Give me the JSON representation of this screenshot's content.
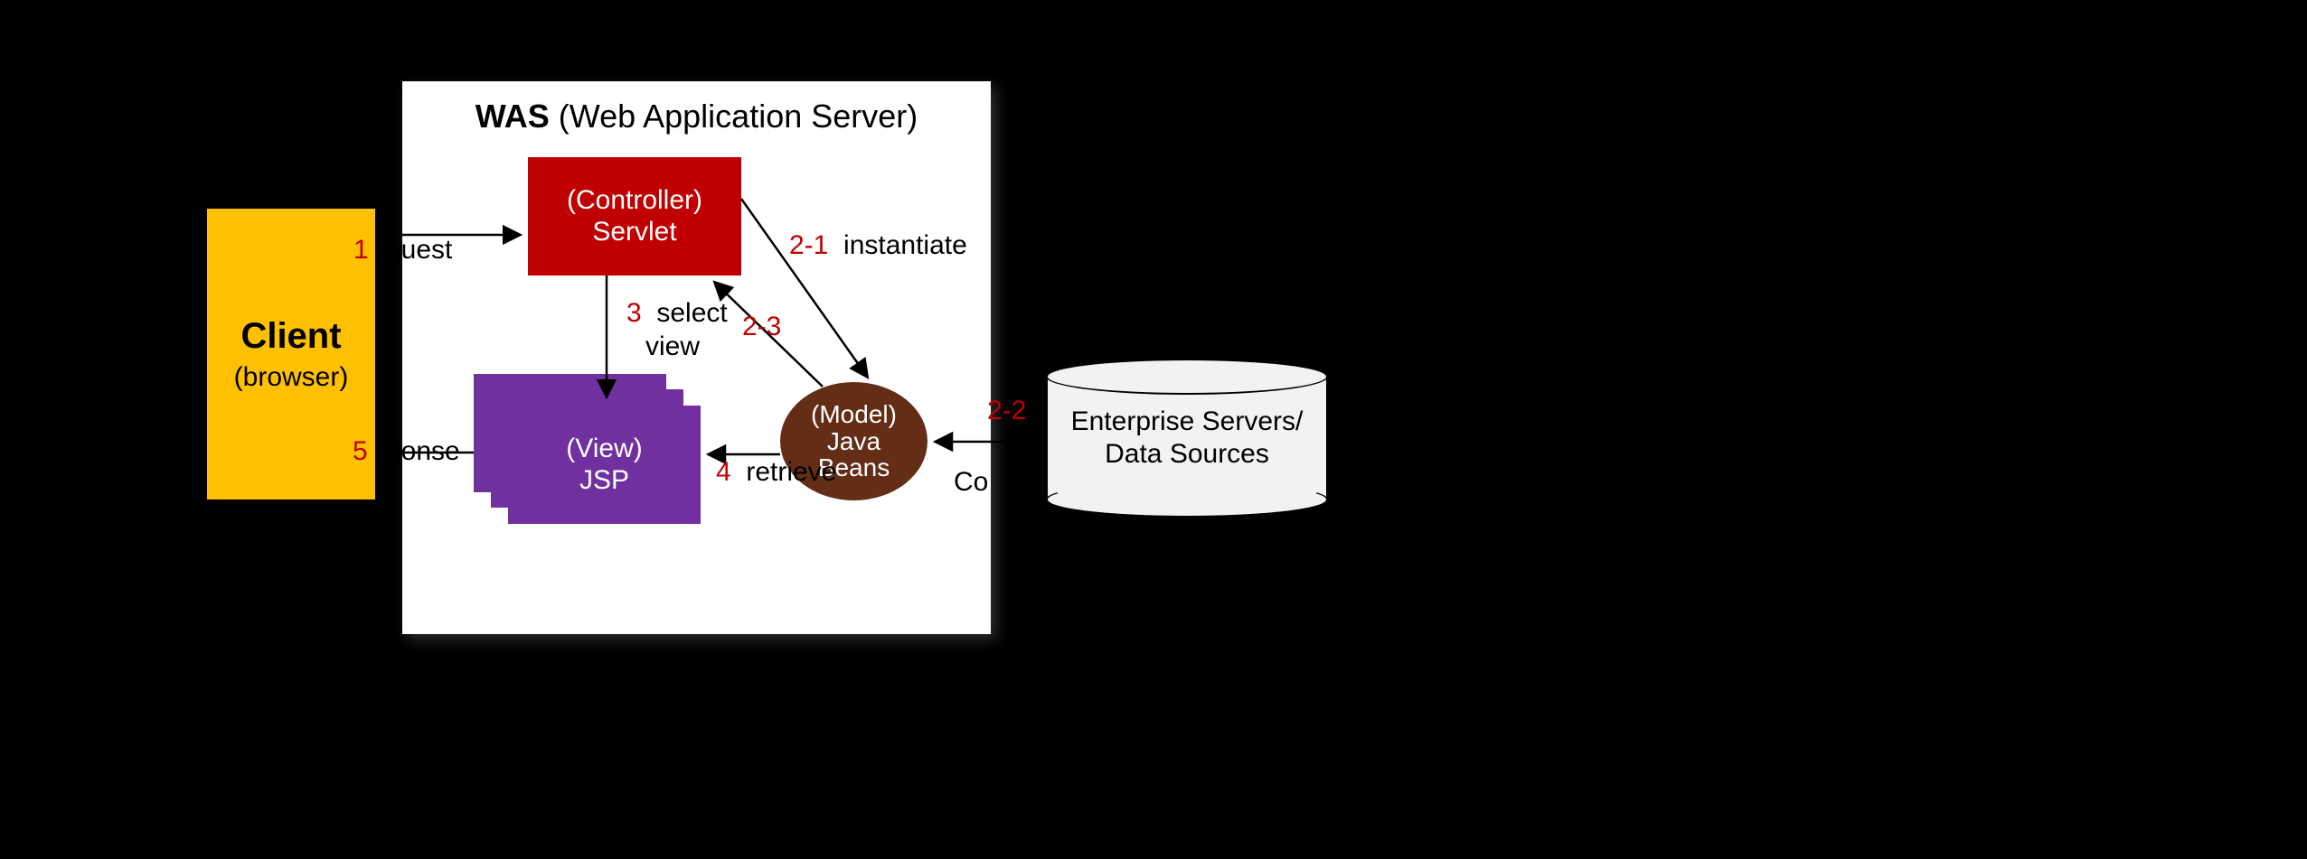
{
  "client": {
    "title": "Client",
    "sub": "(browser)"
  },
  "was": {
    "title_bold": "WAS",
    "title_rest": " (Web Application Server)"
  },
  "controller": {
    "role": "(Controller)",
    "name": "Servlet"
  },
  "view": {
    "role": "(View)",
    "name": "JSP"
  },
  "model": {
    "role": "(Model)",
    "name1": "Java",
    "name2": "Beans"
  },
  "db": {
    "line1": "Enterprise Servers/",
    "line2": "Data Sources"
  },
  "steps": {
    "s1": "1",
    "s1_txt": "quest",
    "s2_1": "2-1",
    "s2_1_txt": "instantiate",
    "s2_3": "2-3",
    "s3": "3",
    "s3_txt1": "select",
    "s3_txt2": "view",
    "s4": "4",
    "s4_txt": "retrieve",
    "s5": "5",
    "s5_txt": "ponse",
    "s2_2": "2-2",
    "co": "Co"
  }
}
